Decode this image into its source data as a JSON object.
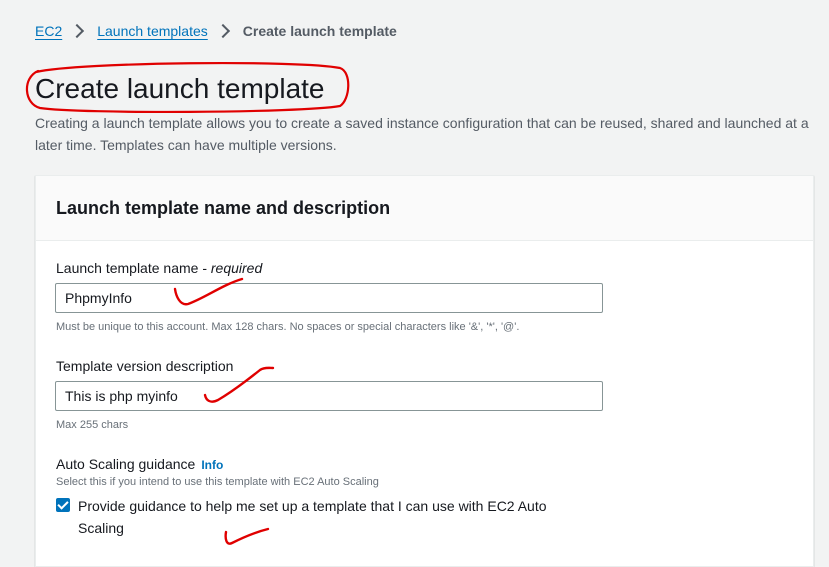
{
  "breadcrumb": {
    "items": [
      {
        "label": "EC2"
      },
      {
        "label": "Launch templates"
      }
    ],
    "current": "Create launch template"
  },
  "page": {
    "title": "Create launch template",
    "description": "Creating a launch template allows you to create a saved instance configuration that can be reused, shared and launched at a later time. Templates can have multiple versions."
  },
  "panel": {
    "title": "Launch template name and description",
    "name_field": {
      "label": "Launch template name - ",
      "required": "required",
      "value": "PhpmyInfo",
      "hint": "Must be unique to this account. Max 128 chars. No spaces or special characters like '&', '*', '@'."
    },
    "description_field": {
      "label": "Template version description",
      "value": "This is php myinfo",
      "hint": "Max 255 chars"
    },
    "autoscaling": {
      "label": "Auto Scaling guidance",
      "info": "Info",
      "hint": "Select this if you intend to use this template with EC2 Auto Scaling",
      "checkbox_label": "Provide guidance to help me set up a template that I can use with EC2 Auto Scaling",
      "checked": true
    }
  },
  "colors": {
    "link": "#0073bb",
    "annotation": "#e00000"
  }
}
